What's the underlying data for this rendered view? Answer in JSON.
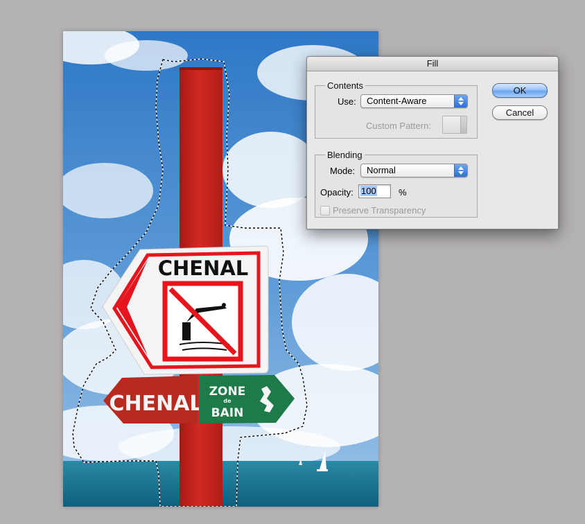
{
  "photo": {
    "sign_main_text": "CHENAL",
    "arrow_left_text": "CHENAL",
    "arrow_right_line1": "ZONE",
    "arrow_right_line2": "de",
    "arrow_right_line3": "BAIN"
  },
  "dialog": {
    "title": "Fill",
    "contents": {
      "legend": "Contents",
      "use_label": "Use:",
      "use_value": "Content-Aware",
      "custom_pattern_label": "Custom Pattern:"
    },
    "blending": {
      "legend": "Blending",
      "mode_label": "Mode:",
      "mode_value": "Normal",
      "opacity_label": "Opacity:",
      "opacity_value": "100",
      "opacity_unit": "%",
      "preserve_label": "Preserve Transparency",
      "preserve_checked": false
    },
    "ok_label": "OK",
    "cancel_label": "Cancel"
  },
  "colors": {
    "background": "#b5b2b3",
    "sky": "#3f86cf",
    "post": "#c8231d",
    "sign_red": "#e5141d",
    "arrow_green": "#1f7a4a",
    "sea": "#1f7d9a"
  }
}
